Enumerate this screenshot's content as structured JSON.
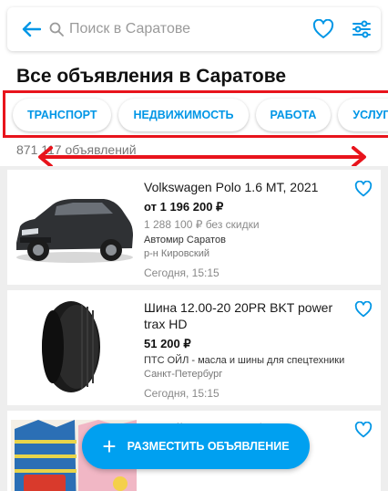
{
  "search": {
    "placeholder": "Поиск в Саратове"
  },
  "page_title": "Все объявления в Саратове",
  "categories": [
    {
      "label": "ТРАНСПОРТ"
    },
    {
      "label": "НЕДВИЖИМОСТЬ"
    },
    {
      "label": "РАБОТА"
    },
    {
      "label": "УСЛУГИ"
    }
  ],
  "listing_count": "871 117 объявлений",
  "listings": [
    {
      "title": "Volkswagen Polo 1.6 MT, 2021",
      "price": "от 1 196 200 ₽",
      "old_price": "1 288 100 ₽ без скидки",
      "seller": "Автомир Саратов",
      "location": "р-н Кировский",
      "date": "Сегодня, 15:15",
      "image_icon": "car-photo"
    },
    {
      "title": "Шина 12.00-20 20PR BKT power trax HD",
      "price": "51 200 ₽",
      "seller": "ПТС ОЙЛ - масла и шины для спецтехники",
      "location": "Санкт-Петербург",
      "date": "Сегодня, 15:15",
      "image_icon": "tire-photo"
    },
    {
      "title": "Новый песочник и боди",
      "image_icon": "baby-clothes-photo"
    }
  ],
  "fab": {
    "label": "РАЗМЕСТИТЬ ОБЪЯВЛЕНИЕ"
  },
  "colors": {
    "accent": "#0096e6",
    "annotation_red": "#e8141c",
    "fab": "#00a0f0"
  }
}
